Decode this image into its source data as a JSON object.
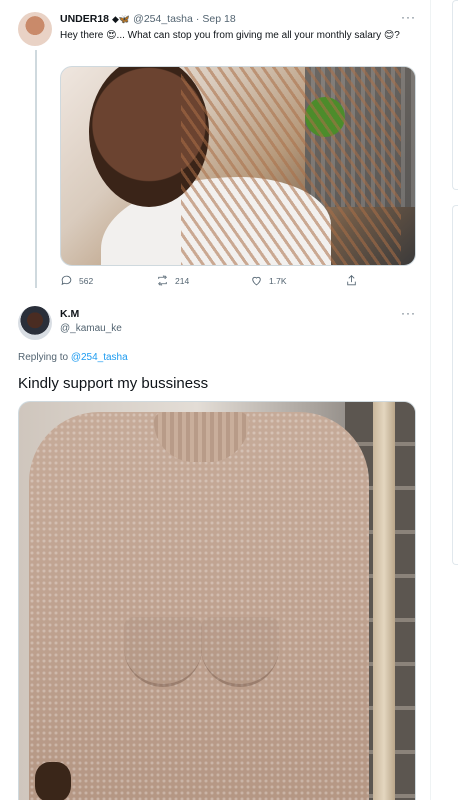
{
  "tweet1": {
    "display_name": "UNDER18",
    "name_emoji": "◆🦋",
    "handle": "@254_tasha",
    "separator": "·",
    "date": "Sep 18",
    "more": "···",
    "text": "Hey there 😍... What can stop you from giving me all your monthly salary 😊?",
    "actions": {
      "reply_count": "562",
      "retweet_count": "214",
      "like_count": "1.7K"
    }
  },
  "tweet2": {
    "display_name": "K.M",
    "handle": "@_kamau_ke",
    "more": "···",
    "replying_prefix": "Replying to",
    "replying_to": "@254_tasha",
    "text": "Kindly support my bussiness"
  }
}
